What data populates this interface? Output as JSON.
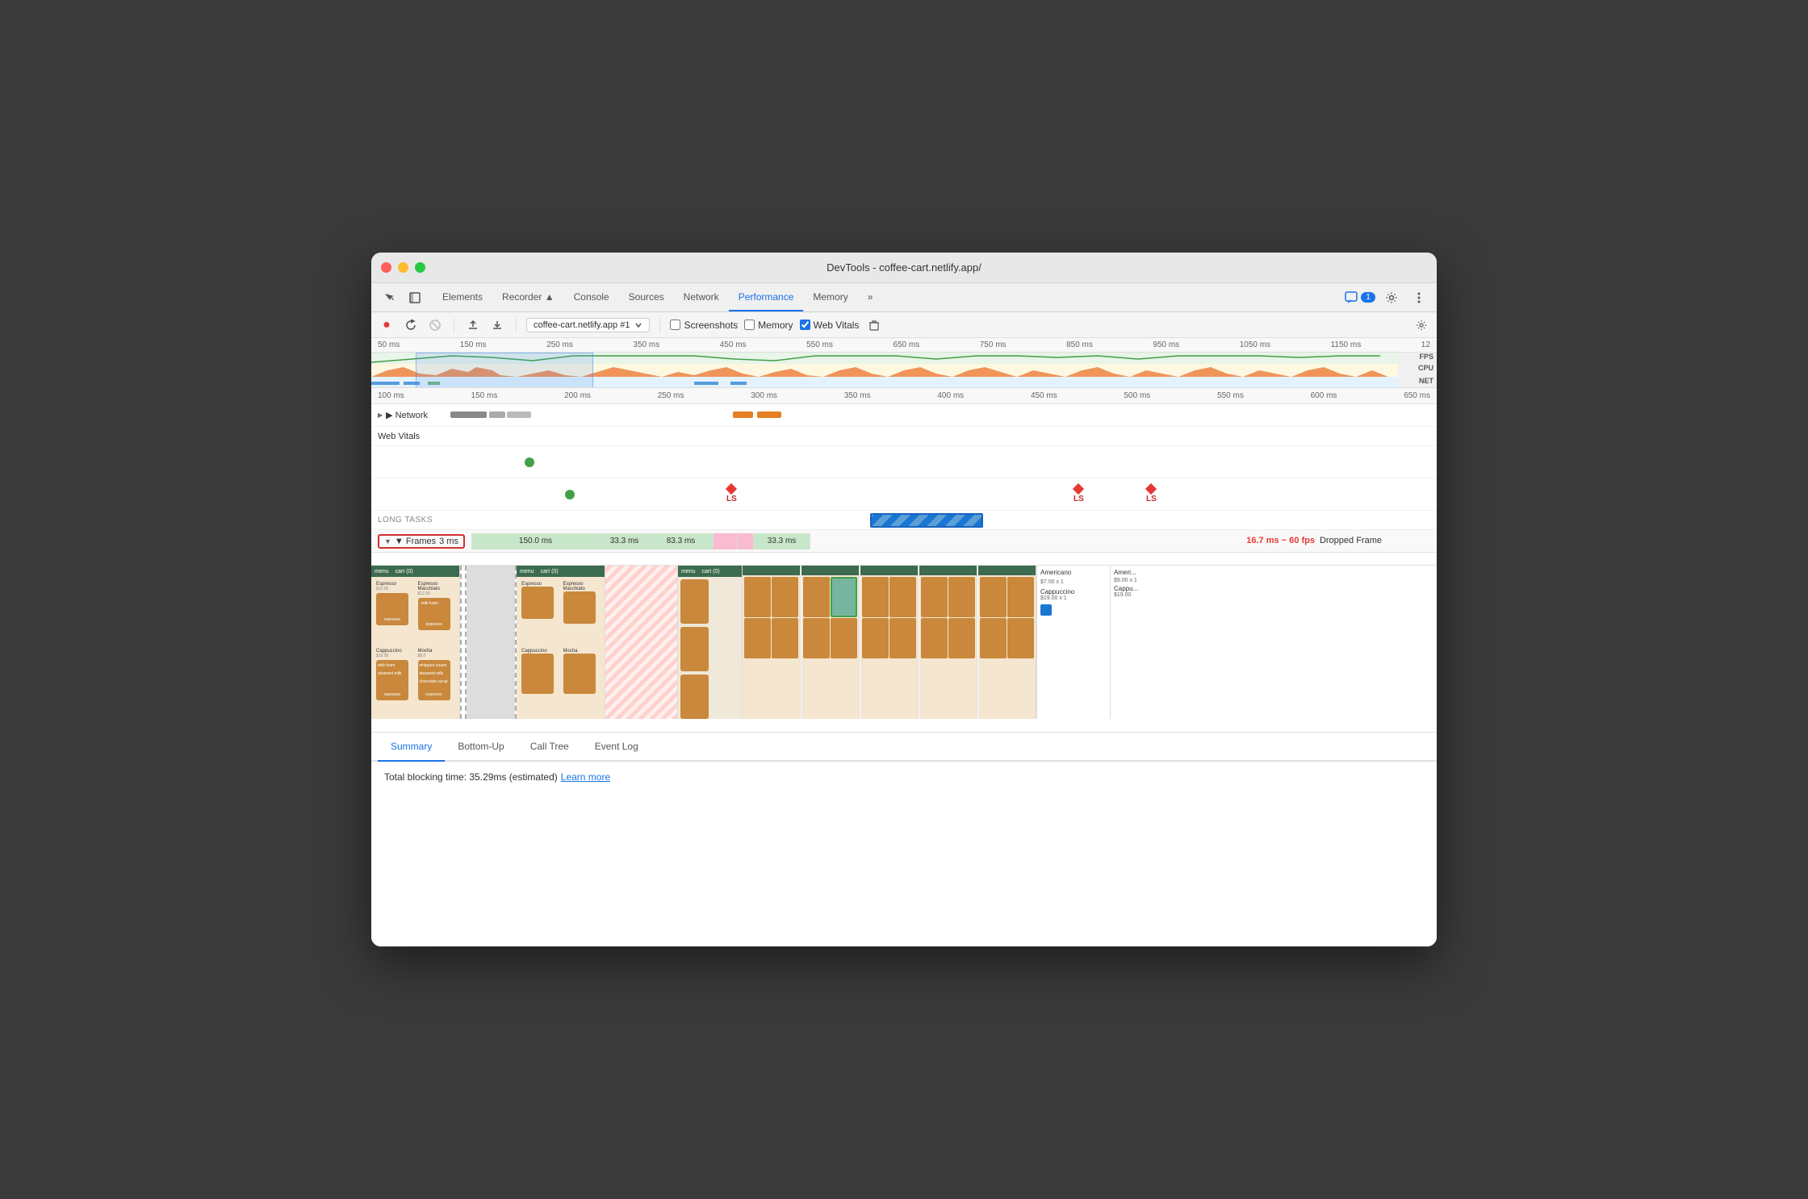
{
  "window": {
    "title": "DevTools - coffee-cart.netlify.app/"
  },
  "traffic_lights": {
    "red": "red",
    "yellow": "yellow",
    "green": "green"
  },
  "tabs": [
    {
      "label": "Elements",
      "active": false
    },
    {
      "label": "Recorder ▲",
      "active": false
    },
    {
      "label": "Console",
      "active": false
    },
    {
      "label": "Sources",
      "active": false
    },
    {
      "label": "Network",
      "active": false
    },
    {
      "label": "Performance",
      "active": true
    },
    {
      "label": "Memory",
      "active": false
    },
    {
      "label": "»",
      "active": false
    }
  ],
  "toolbar": {
    "record_label": "●",
    "reload_label": "↺",
    "clear_label": "🚫",
    "upload_label": "↑",
    "download_label": "↓",
    "profile_select": "coffee-cart.netlify.app #1",
    "screenshots_label": "Screenshots",
    "memory_label": "Memory",
    "web_vitals_label": "Web Vitals",
    "trash_label": "🗑",
    "settings_label": "⚙"
  },
  "badge_count": "1",
  "timeline": {
    "overview_marks": [
      "50 ms",
      "150 ms",
      "250 ms",
      "350 ms",
      "450 ms",
      "550 ms",
      "650 ms",
      "750 ms",
      "850 ms",
      "950 ms",
      "1050 ms",
      "1150 ms",
      "12"
    ],
    "detail_marks": [
      "100 ms",
      "150 ms",
      "200 ms",
      "250 ms",
      "300 ms",
      "350 ms",
      "400 ms",
      "450 ms",
      "500 ms",
      "550 ms",
      "600 ms",
      "650 ms"
    ],
    "labels": {
      "fps": "FPS",
      "cpu": "CPU",
      "net": "NET"
    },
    "network_label": "▶ Network",
    "web_vitals_label": "Web Vitals",
    "long_tasks_label": "LONG TASKS",
    "frames_label": "▼ Frames",
    "frames_time": "3 ms",
    "frame_segments": [
      "150.0 ms",
      "33.3 ms",
      "83.3 ms",
      "33.3 ms"
    ],
    "dropped_frame": "16.7 ms ~ 60 fps",
    "dropped_label": "Dropped Frame"
  },
  "bottom_tabs": [
    {
      "label": "Summary",
      "active": true
    },
    {
      "label": "Bottom-Up",
      "active": false
    },
    {
      "label": "Call Tree",
      "active": false
    },
    {
      "label": "Event Log",
      "active": false
    }
  ],
  "summary": {
    "text": "Total blocking time: 35.29ms (estimated)",
    "learn_more": "Learn more"
  },
  "ls_markers": [
    {
      "label": "LS"
    },
    {
      "label": "LS"
    },
    {
      "label": "LS"
    }
  ]
}
